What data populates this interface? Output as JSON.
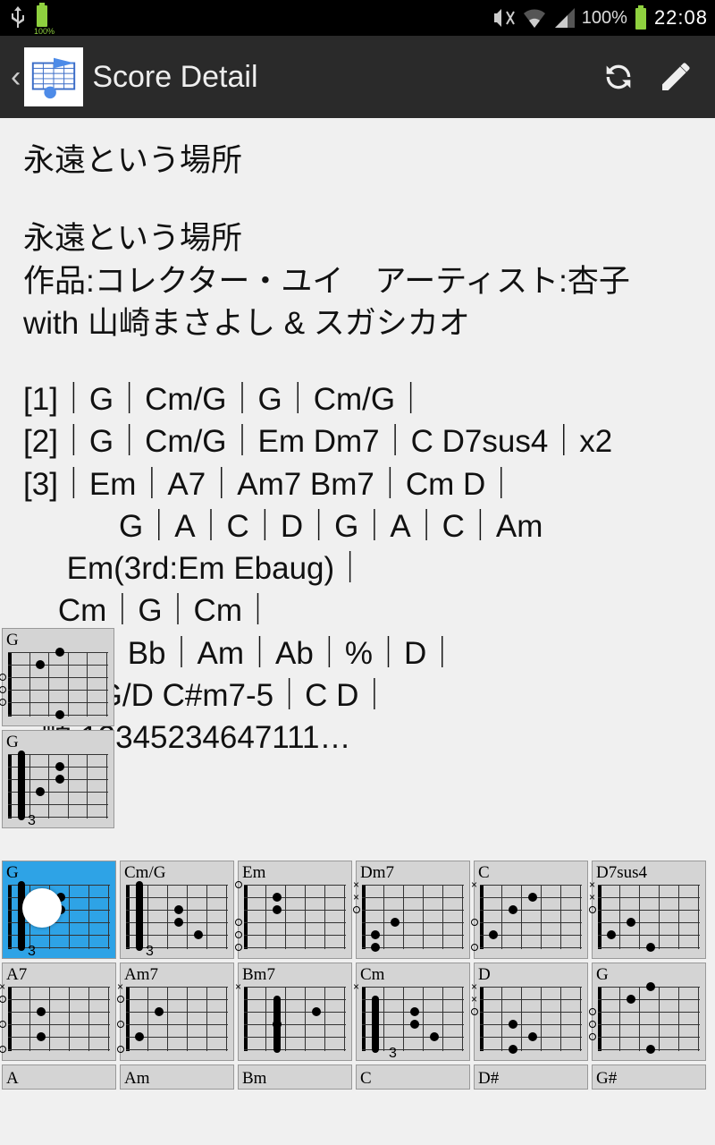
{
  "status": {
    "battery_small_pct": "100%",
    "battery_pct": "100%",
    "time": "22:08"
  },
  "header": {
    "title": "Score Detail"
  },
  "song": {
    "title": "永遠という場所",
    "title2": "永遠という場所",
    "meta": "作品:コレクター・ユイ　アーティスト:杏子 with 山崎まさよし & スガシカオ",
    "lines": [
      "[1]｜G｜Cm/G｜G｜Cm/G｜",
      "[2]｜G｜Cm/G｜Em Dm7｜C D7sus4｜x2",
      "[3]｜Em｜A7｜Am7 Bm7｜Cm D｜",
      "           G｜A｜C｜D｜G｜A｜C｜Am",
      "     Em(3rd:Em Ebaug)｜",
      "    Cm｜G｜Cm｜",
      "    Eb｜Bb｜Am｜Ab｜%｜D｜",
      "  7]｜G/D C#m7-5｜C D｜",
      "  順:12345234647111…"
    ]
  },
  "float_chords": [
    "G",
    "G"
  ],
  "grid": [
    [
      "G",
      "Cm/G",
      "Em",
      "Dm7",
      "C",
      "D7sus4"
    ],
    [
      "A7",
      "Am7",
      "Bm7",
      "Cm",
      "D",
      "G"
    ],
    [
      "A",
      "Am",
      "Bm",
      "C",
      "D#",
      "G#"
    ]
  ],
  "selected_chord_index": 0
}
